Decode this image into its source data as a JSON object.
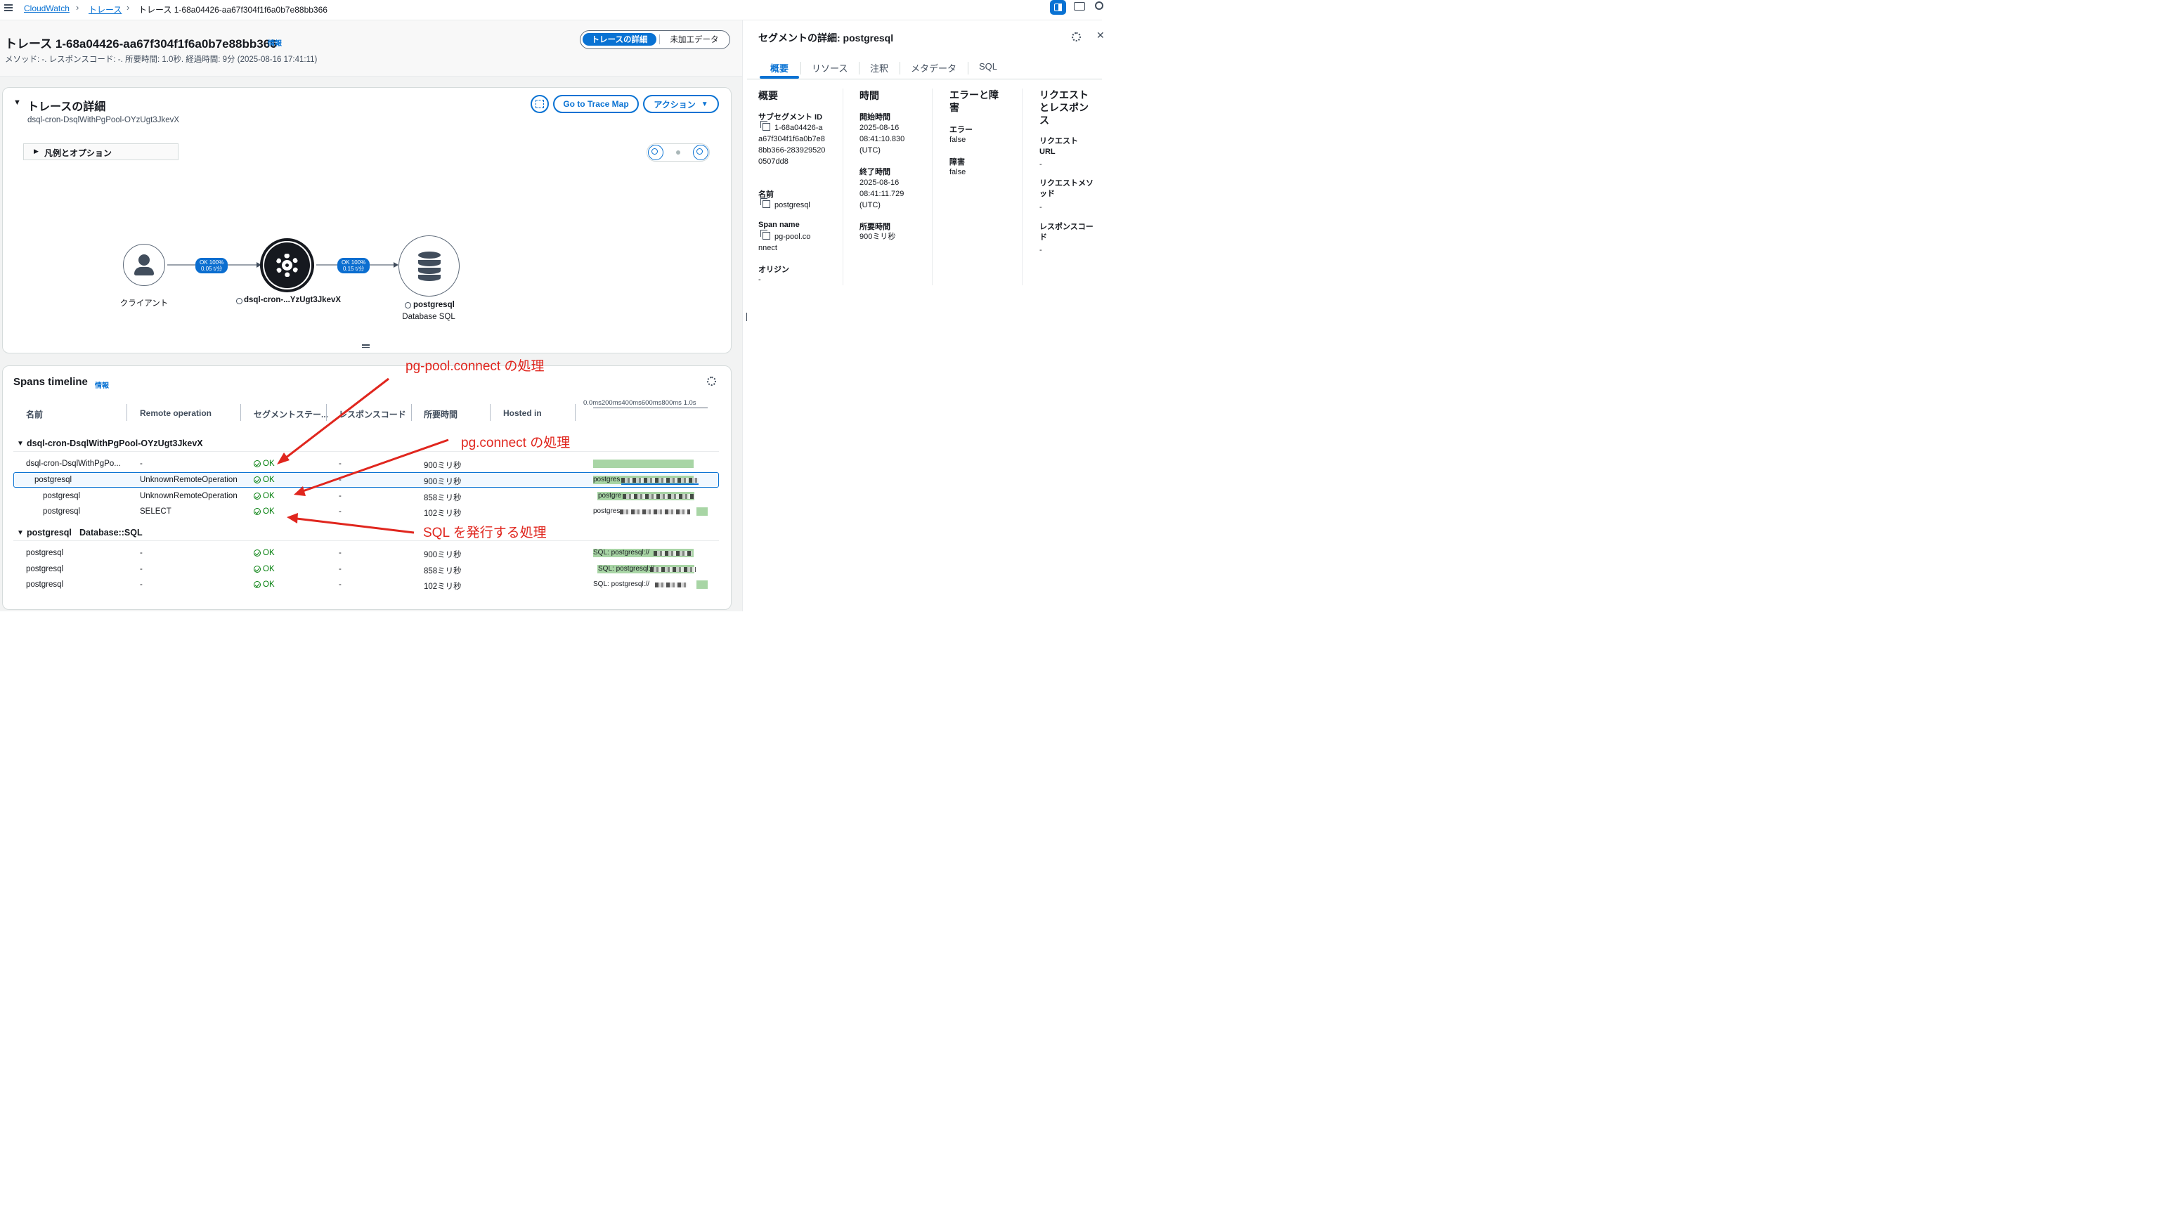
{
  "breadcrumb": {
    "cloudwatch": "CloudWatch",
    "traces": "トレース",
    "current": "トレース 1-68a04426-aa67f304f1f6a0b7e88bb366"
  },
  "header": {
    "title": "トレース 1-68a04426-aa67f304f1f6a0b7e88bb366",
    "info": "情報",
    "subtitle": "メソッド: -. レスポンスコード: -. 所要時間: 1.0秒. 経過時間: 9分 (2025-08-16 17:41:11)",
    "toggle": {
      "active": "トレースの詳細",
      "inactive": "未加工データ"
    }
  },
  "trace_details": {
    "heading": "トレースの詳細",
    "subheading": "dsql-cron-DsqlWithPgPool-OYzUgt3JkevX",
    "legend_toggle": "凡例とオプション",
    "go_to_map": "Go to Trace Map",
    "actions": "アクション",
    "map": {
      "nodes": [
        {
          "label": "クライアント",
          "sub": ""
        },
        {
          "label": "dsql-cron-...YzUgt3JkevX",
          "sub": ""
        },
        {
          "label": "postgresql",
          "sub": "Database SQL"
        }
      ],
      "edges": [
        {
          "line1": "OK 100%",
          "line2": "0.05 t/分"
        },
        {
          "line1": "OK 100%",
          "line2": "0.15 t/分"
        }
      ]
    }
  },
  "spans": {
    "title": "Spans timeline",
    "info": "情報",
    "columns": [
      "名前",
      "Remote operation",
      "セグメントステー...",
      "レスポンスコード",
      "所要時間",
      "Hosted in"
    ],
    "timeline_ticks": "0.0ms200ms400ms600ms800ms 1.0s",
    "groups": [
      {
        "name": "dsql-cron-DsqlWithPgPool-OYzUgt3JkevX",
        "rows": [
          {
            "name": "dsql-cron-DsqlWithPgPo...",
            "remote": "-",
            "status": "OK",
            "code": "-",
            "duration": "900ミリ秒",
            "timeline": "",
            "bar_start": 0.0,
            "bar_frac": 0.9
          },
          {
            "name": "postgresql",
            "remote": "UnknownRemoteOperation",
            "status": "OK",
            "code": "-",
            "duration": "900ミリ秒",
            "timeline": "postgres",
            "bar_start": 0.0,
            "bar_frac": 0.9
          },
          {
            "name": "postgresql",
            "remote": "UnknownRemoteOperation",
            "status": "OK",
            "code": "-",
            "duration": "858ミリ秒",
            "timeline": "postgre",
            "bar_start": 0.0,
            "bar_frac": 0.86
          },
          {
            "name": "postgresql",
            "remote": "SELECT",
            "status": "OK",
            "code": "-",
            "duration": "102ミリ秒",
            "timeline": "postgres",
            "bar_start": 0.9,
            "bar_frac": 0.1
          }
        ]
      },
      {
        "name": "postgresql",
        "type": "Database::SQL",
        "rows": [
          {
            "name": "postgresql",
            "remote": "-",
            "status": "OK",
            "code": "-",
            "duration": "900ミリ秒",
            "timeline": "SQL: postgresql://",
            "bar_start": 0.0,
            "bar_frac": 0.9
          },
          {
            "name": "postgresql",
            "remote": "-",
            "status": "OK",
            "code": "-",
            "duration": "858ミリ秒",
            "timeline": "SQL: postgresql://",
            "bar_start": 0.0,
            "bar_frac": 0.86
          },
          {
            "name": "postgresql",
            "remote": "-",
            "status": "OK",
            "code": "-",
            "duration": "102ミリ秒",
            "timeline": "SQL: postgresql://",
            "bar_start": 0.9,
            "bar_frac": 0.1
          }
        ]
      }
    ]
  },
  "annotations": {
    "a1": "pg-pool.connect の処理",
    "a2": "pg.connect の処理",
    "a3": "SQL を発行する処理"
  },
  "segment_panel": {
    "title": "セグメントの詳細: postgresql",
    "tabs": [
      "概要",
      "リソース",
      "注釈",
      "メタデータ",
      "SQL"
    ],
    "overview": {
      "heading": "概要",
      "subsegment_id_label": "サブセグメント ID",
      "subsegment_id": "1-68a04426-aa67f304f1f6a0b7e88bb366-2839295200507dd8",
      "name_label": "名前",
      "name": "postgresql",
      "span_name_label": "Span name",
      "span_name": "pg-pool.connect",
      "origin_label": "オリジン",
      "origin": "-"
    },
    "time": {
      "heading": "時間",
      "start_label": "開始時間",
      "start": "2025-08-16 08:41:10.830 (UTC)",
      "end_label": "終了時間",
      "end": "2025-08-16 08:41:11.729 (UTC)",
      "duration_label": "所要時間",
      "duration": "900ミリ秒"
    },
    "errors": {
      "heading": "エラーと障害",
      "error_label": "エラー",
      "error": "false",
      "fault_label": "障害",
      "fault": "false"
    },
    "request": {
      "heading": "リクエストとレスポンス",
      "url_label": "リクエスト URL",
      "url": "-",
      "method_label": "リクエストメソッド",
      "method": "-",
      "code_label": "レスポンスコード",
      "code": "-"
    }
  },
  "colors": {
    "accent": "#0972d3",
    "ok": "#037f0c",
    "annotation": "#e0261e",
    "bar": "#a8d5a5"
  }
}
